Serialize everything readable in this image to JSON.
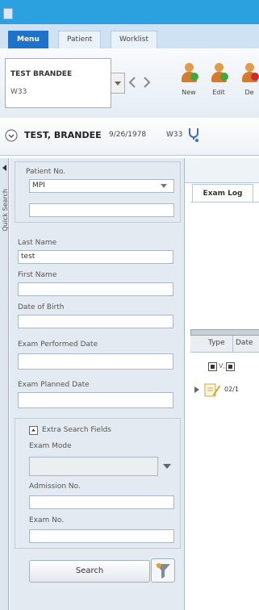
{
  "tabs": [
    "Menu",
    "Patient",
    "Worklist"
  ],
  "ribbon": {
    "patient_name": "TEST BRANDEE",
    "patient_ward": "W33",
    "buttons": [
      "New",
      "Edit",
      "De"
    ]
  },
  "header": {
    "patient_name": "TEST, BRANDEE",
    "dob": "9/26/1978",
    "ward": "W33"
  },
  "quick_search": {
    "label": "Quick Search",
    "patient_no_label": "Patient No.",
    "patient_no_value": "MPI",
    "last_name_label": "Last Name",
    "last_name_value": "test",
    "first_name_label": "First Name",
    "dob_label": "Date of Birth",
    "exam_performed_label": "Exam Performed Date",
    "exam_planned_label": "Exam Planned Date",
    "extra_fields_label": "Extra Search Fields",
    "exam_mode_label": "Exam Mode",
    "admission_label": "Admission No.",
    "exam_no_label": "Exam No.",
    "search_button": "Search"
  },
  "exam_log": {
    "tab": "Exam Log",
    "columns": [
      "Type",
      "Date"
    ],
    "row_date": "02/1"
  },
  "colors": {
    "title_bar": "#2ba1e0",
    "menu_tab": "#1f72c9"
  }
}
